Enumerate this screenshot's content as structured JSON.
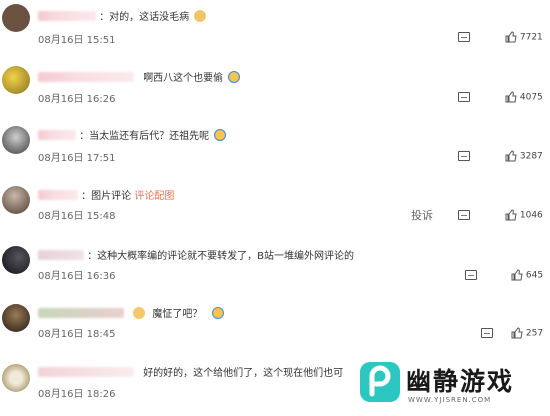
{
  "comments": [
    {
      "text": "：对的，这话没毛病",
      "emoji_name": "dog-face-emoji",
      "date": "08月16日",
      "time": "15:51",
      "likes": "7721",
      "avatar_color": "#6b5140"
    },
    {
      "text": "啊西八这个也要偷",
      "emoji_name": "laughing-crying-emoji",
      "date": "08月16日",
      "time": "16:26",
      "likes": "4075",
      "avatar_color": "#c7a73a"
    },
    {
      "text": "：当太监还有后代？还祖先呢",
      "emoji_name": "laughing-crying-emoji",
      "date": "08月16日",
      "time": "17:51",
      "likes": "3287",
      "avatar_color": "#4a4a4a"
    },
    {
      "text": "：图片评论 ",
      "link": "评论配图",
      "date": "08月16日",
      "time": "15:48",
      "likes": "1046",
      "report": "投诉",
      "avatar_color": "#7a6a5c"
    },
    {
      "text": "：这种大概率编的评论就不要转发了，B站一堆编外网评论的",
      "date": "08月16日",
      "time": "16:36",
      "likes": "645",
      "avatar_color": "#1e1e22"
    },
    {
      "text": "魔怔了吧？",
      "emoji_name": "surprised-emoji",
      "emoji2_name": "wrench-emoji",
      "date": "08月16日",
      "time": "18:45",
      "likes": "257",
      "avatar_color": "#3a2f2a"
    },
    {
      "text": "好的好的，这个给他们了，这个现在他们也可",
      "date": "08月16日",
      "time": "18:26",
      "avatar_color": "#d8cdb8"
    }
  ],
  "watermark": {
    "title": "幽静游戏",
    "subtitle": "WWW.YJISREN.COM",
    "color": "#2cc7c0"
  }
}
